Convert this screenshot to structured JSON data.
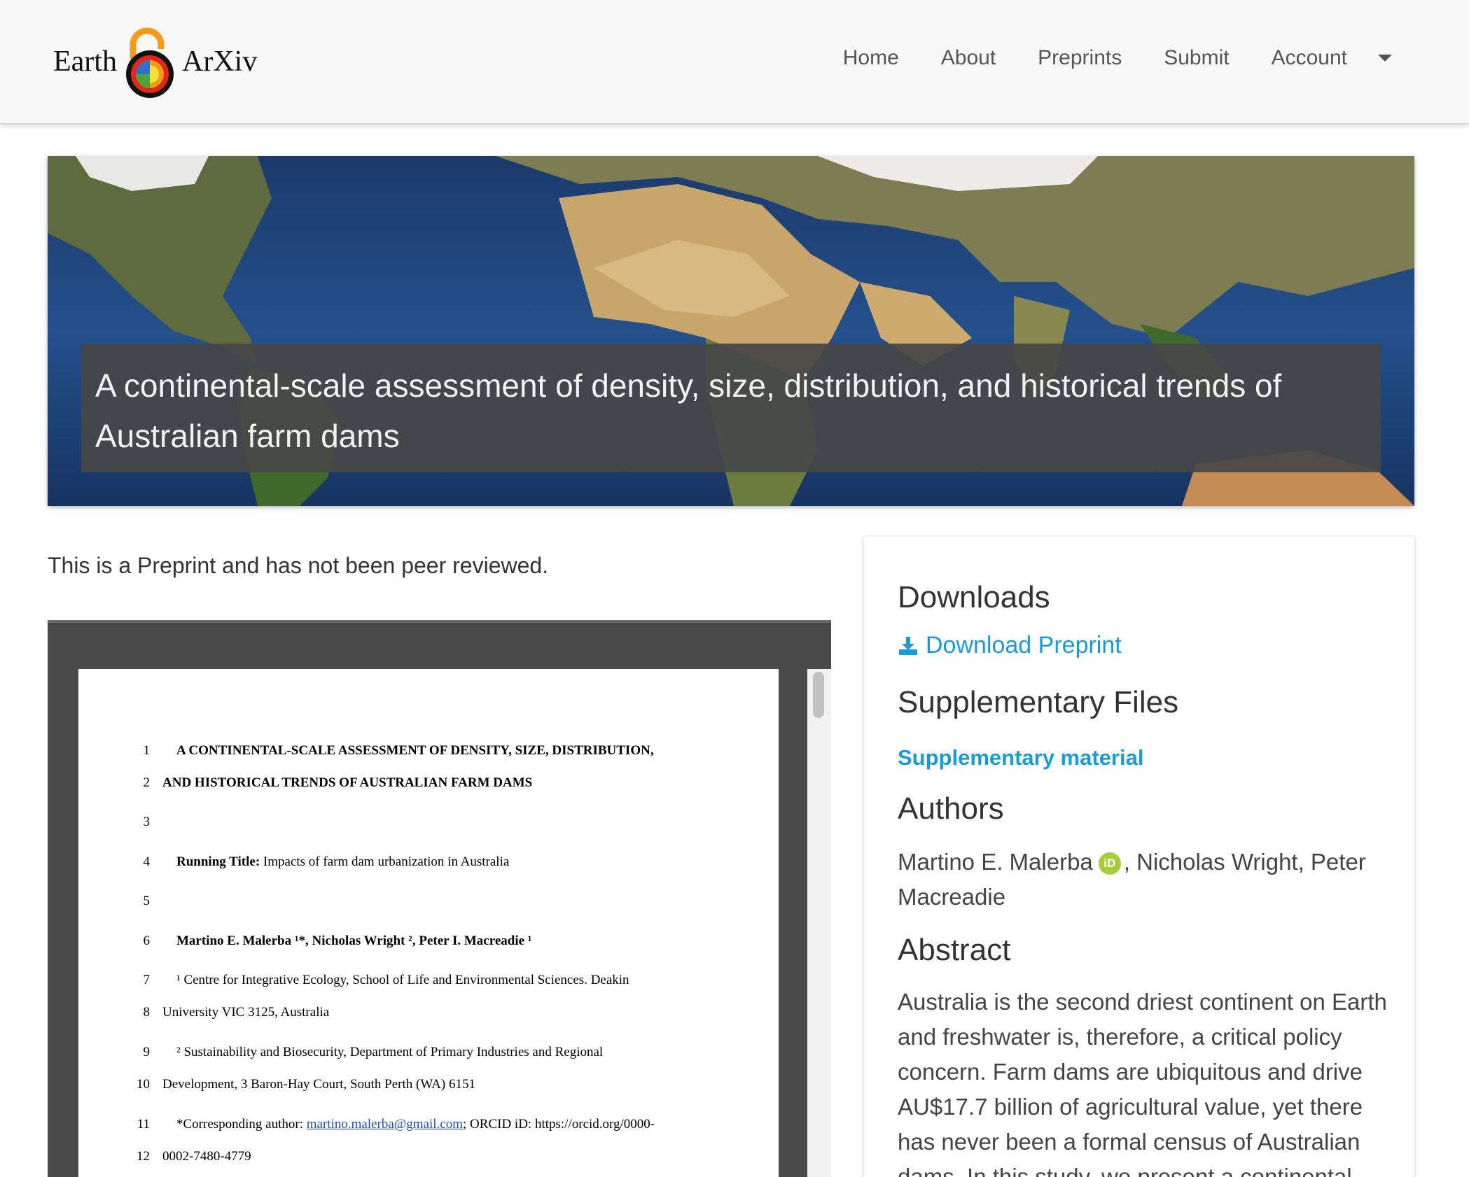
{
  "header": {
    "logo_left": "Earth",
    "logo_right": "ArXiv",
    "nav": [
      "Home",
      "About",
      "Preprints",
      "Submit",
      "Account"
    ]
  },
  "hero": {
    "title": "A continental-scale assessment of density, size, distribution, and historical trends of Australian farm dams"
  },
  "notice": "This is a Preprint and has not been peer reviewed.",
  "pdf": {
    "lines": [
      {
        "n": "1",
        "text": "A CONTINENTAL-SCALE ASSESSMENT OF DENSITY, SIZE, DISTRIBUTION,"
      },
      {
        "n": "2",
        "text": "AND HISTORICAL TRENDS OF AUSTRALIAN FARM DAMS"
      },
      {
        "n": "3",
        "text": ""
      },
      {
        "n": "4",
        "label": "Running Title:",
        "text": " Impacts of farm dam urbanization in Australia"
      },
      {
        "n": "5",
        "text": ""
      },
      {
        "n": "6",
        "text": "Martino E. Malerba ¹*, Nicholas Wright ², Peter I. Macreadie ¹"
      },
      {
        "n": "7",
        "text": "¹ Centre for Integrative Ecology, School of Life and Environmental Sciences. Deakin"
      },
      {
        "n": "8",
        "text": "University VIC 3125, Australia"
      },
      {
        "n": "9",
        "text": "² Sustainability and Biosecurity, Department of Primary Industries and Regional"
      },
      {
        "n": "10",
        "text": "Development, 3 Baron-Hay Court, South Perth (WA) 6151"
      },
      {
        "n": "11",
        "pre": "*Corresponding author: ",
        "link": "martino.malerba@gmail.com",
        "post": "; ORCID iD: https://orcid.org/0000-"
      },
      {
        "n": "12",
        "text": "0002-7480-4779"
      }
    ]
  },
  "sidebar": {
    "downloads_heading": "Downloads",
    "download_label": "Download Preprint",
    "supp_heading": "Supplementary Files",
    "supp_link": "Supplementary material",
    "authors_heading": "Authors",
    "author1": "Martino E. Malerba",
    "orcid_badge": "iD",
    "authors_rest": ", Nicholas Wright, Peter Macreadie",
    "abstract_heading": "Abstract",
    "abstract": "Australia is the second driest continent on Earth and freshwater is, therefore, a critical policy concern. Farm dams are ubiquitous and drive AU$17.7 billion of agricultural value, yet there has never been a formal census of Australian dams. In this study, we present a continental-"
  },
  "colors": {
    "link": "#1a9ad6",
    "orcid": "#a6ce39",
    "hero_overlay": "#464646"
  }
}
